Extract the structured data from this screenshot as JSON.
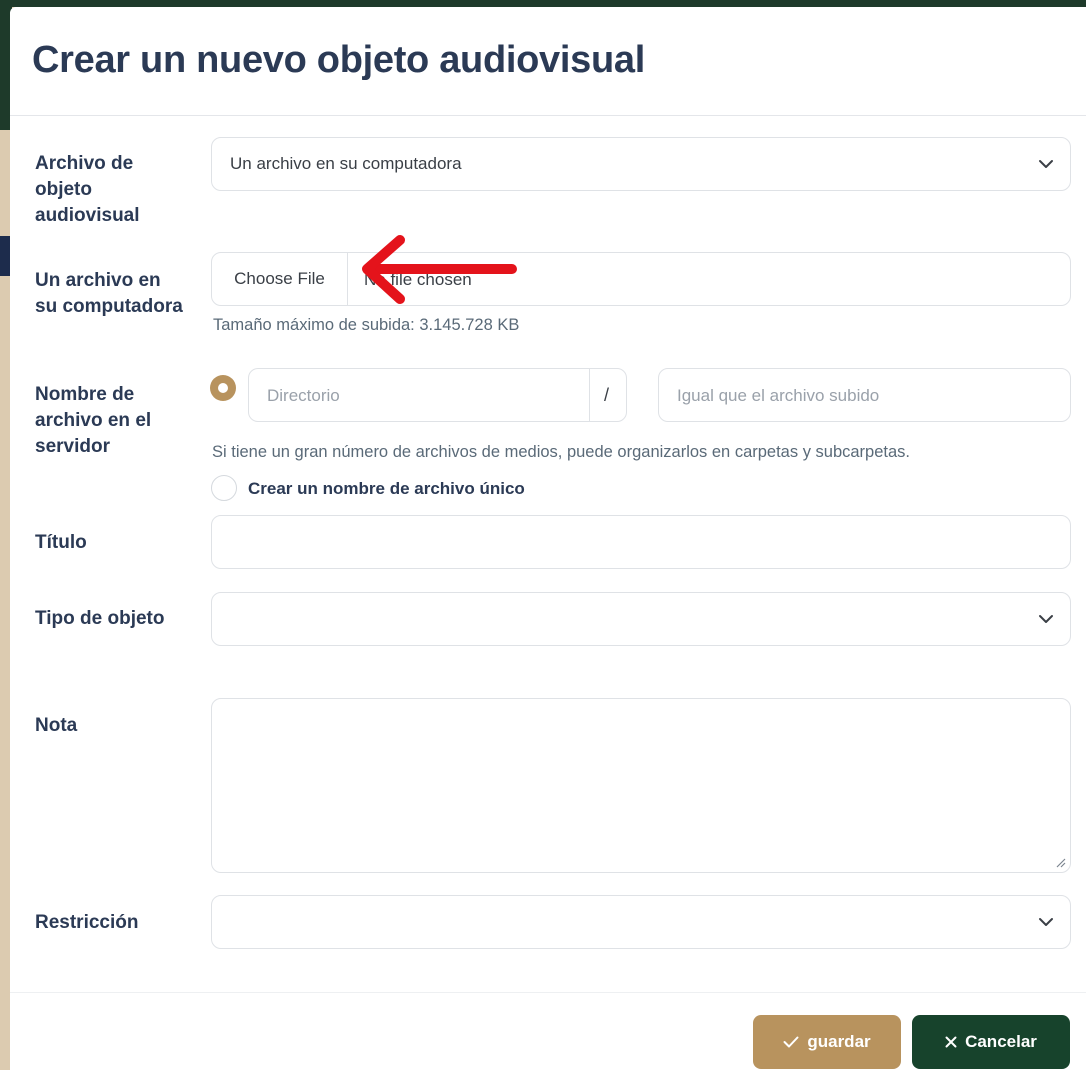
{
  "title": "Crear un nuevo objeto audiovisual",
  "fields": {
    "archivo": {
      "label": "Archivo de objeto audiovisual",
      "value": "Un archivo en su computadora"
    },
    "computadora": {
      "label": "Un archivo en su computadora",
      "button": "Choose File",
      "status": "No file chosen",
      "help": "Tamaño máximo de subida: 3.145.728 KB"
    },
    "nombre": {
      "label": "Nombre de archivo en el servidor",
      "directory_placeholder": "Directorio",
      "separator": "/",
      "filename_placeholder": "Igual que el archivo subido",
      "help": "Si tiene un gran número de archivos de medios, puede organizarlos en carpetas y subcarpetas.",
      "unique_label": "Crear un nombre de archivo único"
    },
    "titulo": {
      "label": "Título",
      "value": ""
    },
    "tipo": {
      "label": "Tipo de objeto",
      "value": ""
    },
    "nota": {
      "label": "Nota",
      "value": ""
    },
    "restriccion": {
      "label": "Restricción",
      "value": ""
    }
  },
  "buttons": {
    "save": "guardar",
    "cancel": "Cancelar"
  },
  "icons": {
    "chevron": "chevron-down-icon",
    "check": "check-icon",
    "close": "close-icon",
    "arrow": "annotation-arrow-icon"
  },
  "colors": {
    "accent": "#b8935e",
    "primary_dark": "#17432c",
    "label": "#2b3a55",
    "annotation": "#e4131b"
  }
}
